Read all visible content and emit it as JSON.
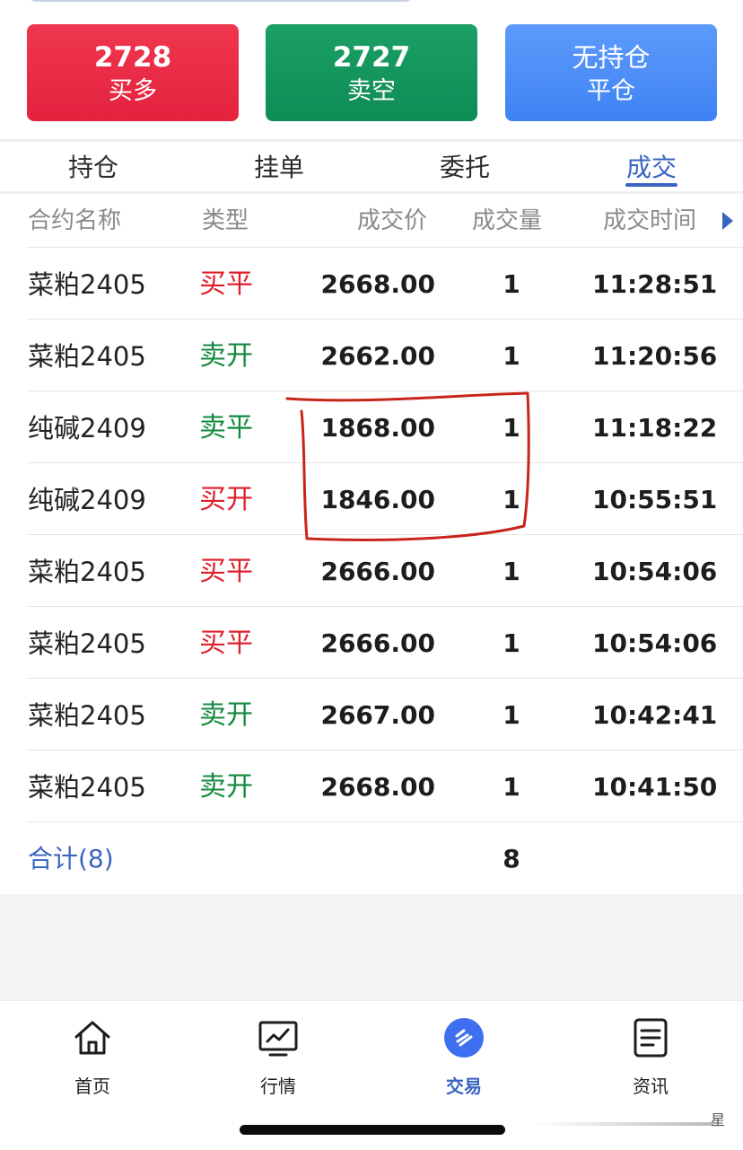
{
  "actions": {
    "buy": {
      "price": "2728",
      "label": "买多"
    },
    "sell": {
      "price": "2727",
      "label": "卖空"
    },
    "close": {
      "status": "无持仓",
      "label": "平仓"
    }
  },
  "tabs": [
    {
      "label": "持仓"
    },
    {
      "label": "挂单"
    },
    {
      "label": "委托"
    },
    {
      "label": "成交",
      "active": true
    }
  ],
  "table": {
    "headers": {
      "name": "合约名称",
      "type": "类型",
      "price": "成交价",
      "qty": "成交量",
      "time": "成交时间"
    },
    "rows": [
      {
        "name": "菜粕2405",
        "type": "买平",
        "type_color": "red",
        "price": "2668.00",
        "qty": "1",
        "time": "11:28:51"
      },
      {
        "name": "菜粕2405",
        "type": "卖开",
        "type_color": "green",
        "price": "2662.00",
        "qty": "1",
        "time": "11:20:56"
      },
      {
        "name": "纯碱2409",
        "type": "卖平",
        "type_color": "green",
        "price": "1868.00",
        "qty": "1",
        "time": "11:18:22"
      },
      {
        "name": "纯碱2409",
        "type": "买开",
        "type_color": "red",
        "price": "1846.00",
        "qty": "1",
        "time": "10:55:51"
      },
      {
        "name": "菜粕2405",
        "type": "买平",
        "type_color": "red",
        "price": "2666.00",
        "qty": "1",
        "time": "10:54:06"
      },
      {
        "name": "菜粕2405",
        "type": "买平",
        "type_color": "red",
        "price": "2666.00",
        "qty": "1",
        "time": "10:54:06"
      },
      {
        "name": "菜粕2405",
        "type": "卖开",
        "type_color": "green",
        "price": "2667.00",
        "qty": "1",
        "time": "10:42:41"
      },
      {
        "name": "菜粕2405",
        "type": "卖开",
        "type_color": "green",
        "price": "2668.00",
        "qty": "1",
        "time": "10:41:50"
      }
    ],
    "total_label": "合计(8)",
    "total_qty": "8"
  },
  "nav": [
    {
      "label": "首页",
      "icon": "home-icon"
    },
    {
      "label": "行情",
      "icon": "chart-icon"
    },
    {
      "label": "交易",
      "icon": "trade-icon",
      "active": true
    },
    {
      "label": "资讯",
      "icon": "news-icon"
    }
  ],
  "watermark": "星",
  "colors": {
    "buy": "#e3223e",
    "sell": "#0e8c55",
    "close": "#3f82f3",
    "accent": "#3a64c0",
    "type_red": "#dd1f2b",
    "type_green": "#15893f",
    "annotation": "#c8251a"
  }
}
